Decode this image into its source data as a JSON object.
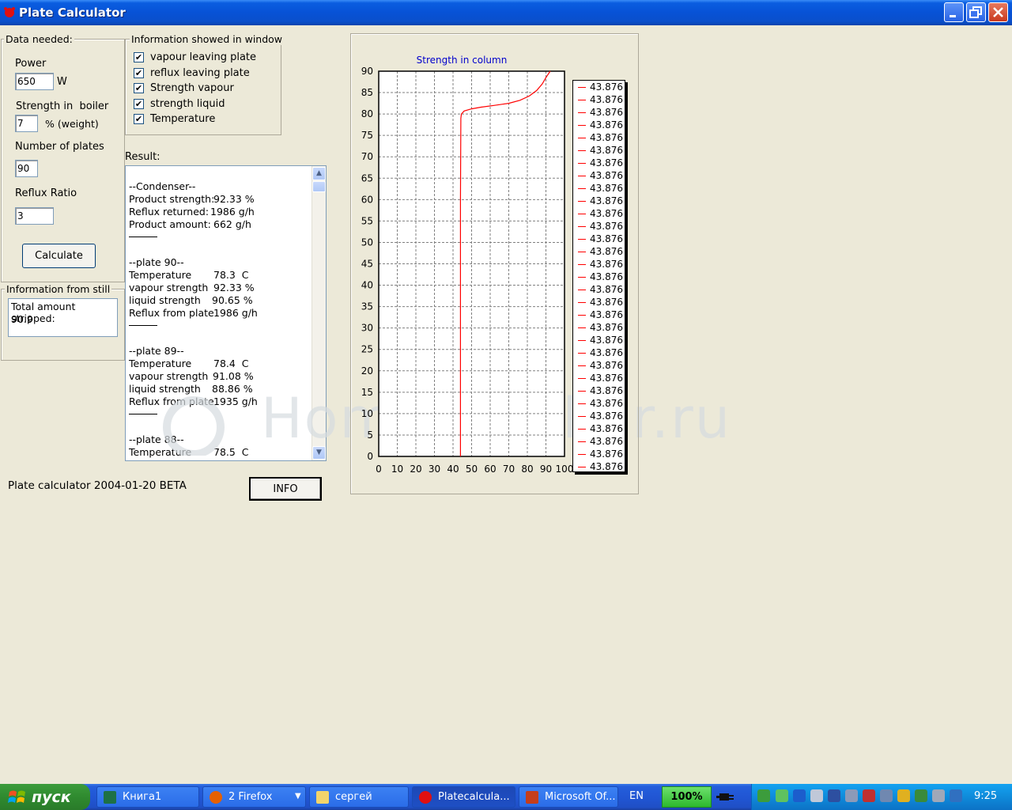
{
  "window": {
    "title": "Plate Calculator"
  },
  "data_needed": {
    "legend": "Data needed:",
    "power_label": "Power",
    "power_value": "650",
    "power_unit": "W",
    "strength_label": "Strength in  boiler",
    "strength_value": "7",
    "strength_unit": "% (weight)",
    "plates_label": "Number of plates",
    "plates_value": "90",
    "reflux_label": "Reflux Ratio",
    "reflux_value": "3",
    "calculate_label": "Calculate"
  },
  "info_window": {
    "legend": "Information showed in window",
    "items": [
      {
        "label": "vapour leaving plate",
        "checked": true
      },
      {
        "label": "reflux leaving plate",
        "checked": true
      },
      {
        "label": "Strength vapour",
        "checked": true
      },
      {
        "label": "strength liquid",
        "checked": true
      },
      {
        "label": "Temperature",
        "checked": true
      }
    ]
  },
  "still": {
    "legend": "Information from still",
    "line1": "Total amount stripped:",
    "line2": "90.9"
  },
  "result": {
    "label": "Result:",
    "condenser": {
      "header": "--Condenser--",
      "rows": [
        {
          "k": "Product strength:",
          "v": "92.33 %"
        },
        {
          "k": "Reflux returned:",
          "v": "1986 g/h"
        },
        {
          "k": "Product amount:",
          "v": "662 g/h"
        }
      ]
    },
    "plates": [
      {
        "header": "--plate 90--",
        "temp": "78.3  C",
        "vapour": "92.33 %",
        "liquid": "90.65 %",
        "reflux": "1986 g/h"
      },
      {
        "header": "--plate 89--",
        "temp": "78.4  C",
        "vapour": "91.08 %",
        "liquid": "88.86 %",
        "reflux": "1935 g/h"
      },
      {
        "header": "--plate 88--",
        "temp": "78.5  C"
      }
    ],
    "keys": {
      "temp": "Temperature",
      "vapour": "vapour strength",
      "liquid": "liquid strength",
      "reflux": "Reflux from plate"
    }
  },
  "footer": {
    "version": "Plate calculator 2004-01-20 BETA",
    "info_label": "INFO"
  },
  "watermark": "HomeDistiller.ru",
  "chart_data": {
    "type": "line",
    "title": "Strength in column",
    "xlim": [
      0,
      100
    ],
    "ylim": [
      0,
      90
    ],
    "xticks": [
      0,
      10,
      20,
      30,
      40,
      50,
      60,
      70,
      80,
      90,
      100
    ],
    "yticks": [
      0,
      5,
      10,
      15,
      20,
      25,
      30,
      35,
      40,
      45,
      50,
      55,
      60,
      65,
      70,
      75,
      80,
      85,
      90
    ],
    "grid": true,
    "line_color": "#FF0000",
    "title_color": "#0000CC",
    "legend_position": "right",
    "legend_entries": [
      "43.876",
      "43.876",
      "43.876",
      "43.876",
      "43.876",
      "43.876",
      "43.876",
      "43.876",
      "43.876",
      "43.876",
      "43.876",
      "43.876",
      "43.876",
      "43.876",
      "43.876",
      "43.876",
      "43.876",
      "43.876",
      "43.876",
      "43.876",
      "43.876",
      "43.876",
      "43.876",
      "43.876",
      "43.876",
      "43.876",
      "43.876",
      "43.876",
      "43.876",
      "43.876",
      "43.876"
    ],
    "series": [
      {
        "x": [
          44,
          44,
          44,
          44.2,
          44.5,
          46,
          50,
          55,
          62,
          70,
          76,
          81,
          85,
          88,
          90,
          92.3
        ],
        "y": [
          0,
          20,
          60,
          79,
          80,
          80.7,
          81.2,
          81.6,
          82,
          82.5,
          83.2,
          84.2,
          85.5,
          87,
          88.5,
          90
        ]
      }
    ]
  },
  "taskbar": {
    "start_label": "пуск",
    "tasks": [
      {
        "label": "Книга1",
        "icon": "excel-icon"
      },
      {
        "label": "2 Firefox",
        "icon": "firefox-icon"
      },
      {
        "label": "сергей",
        "icon": "folder-icon"
      },
      {
        "label": "Platecalcula...",
        "icon": "app-icon"
      },
      {
        "label": "Microsoft Of...",
        "icon": "office-icon"
      }
    ],
    "language": "EN",
    "battery": "100%",
    "clock": "9:25"
  }
}
